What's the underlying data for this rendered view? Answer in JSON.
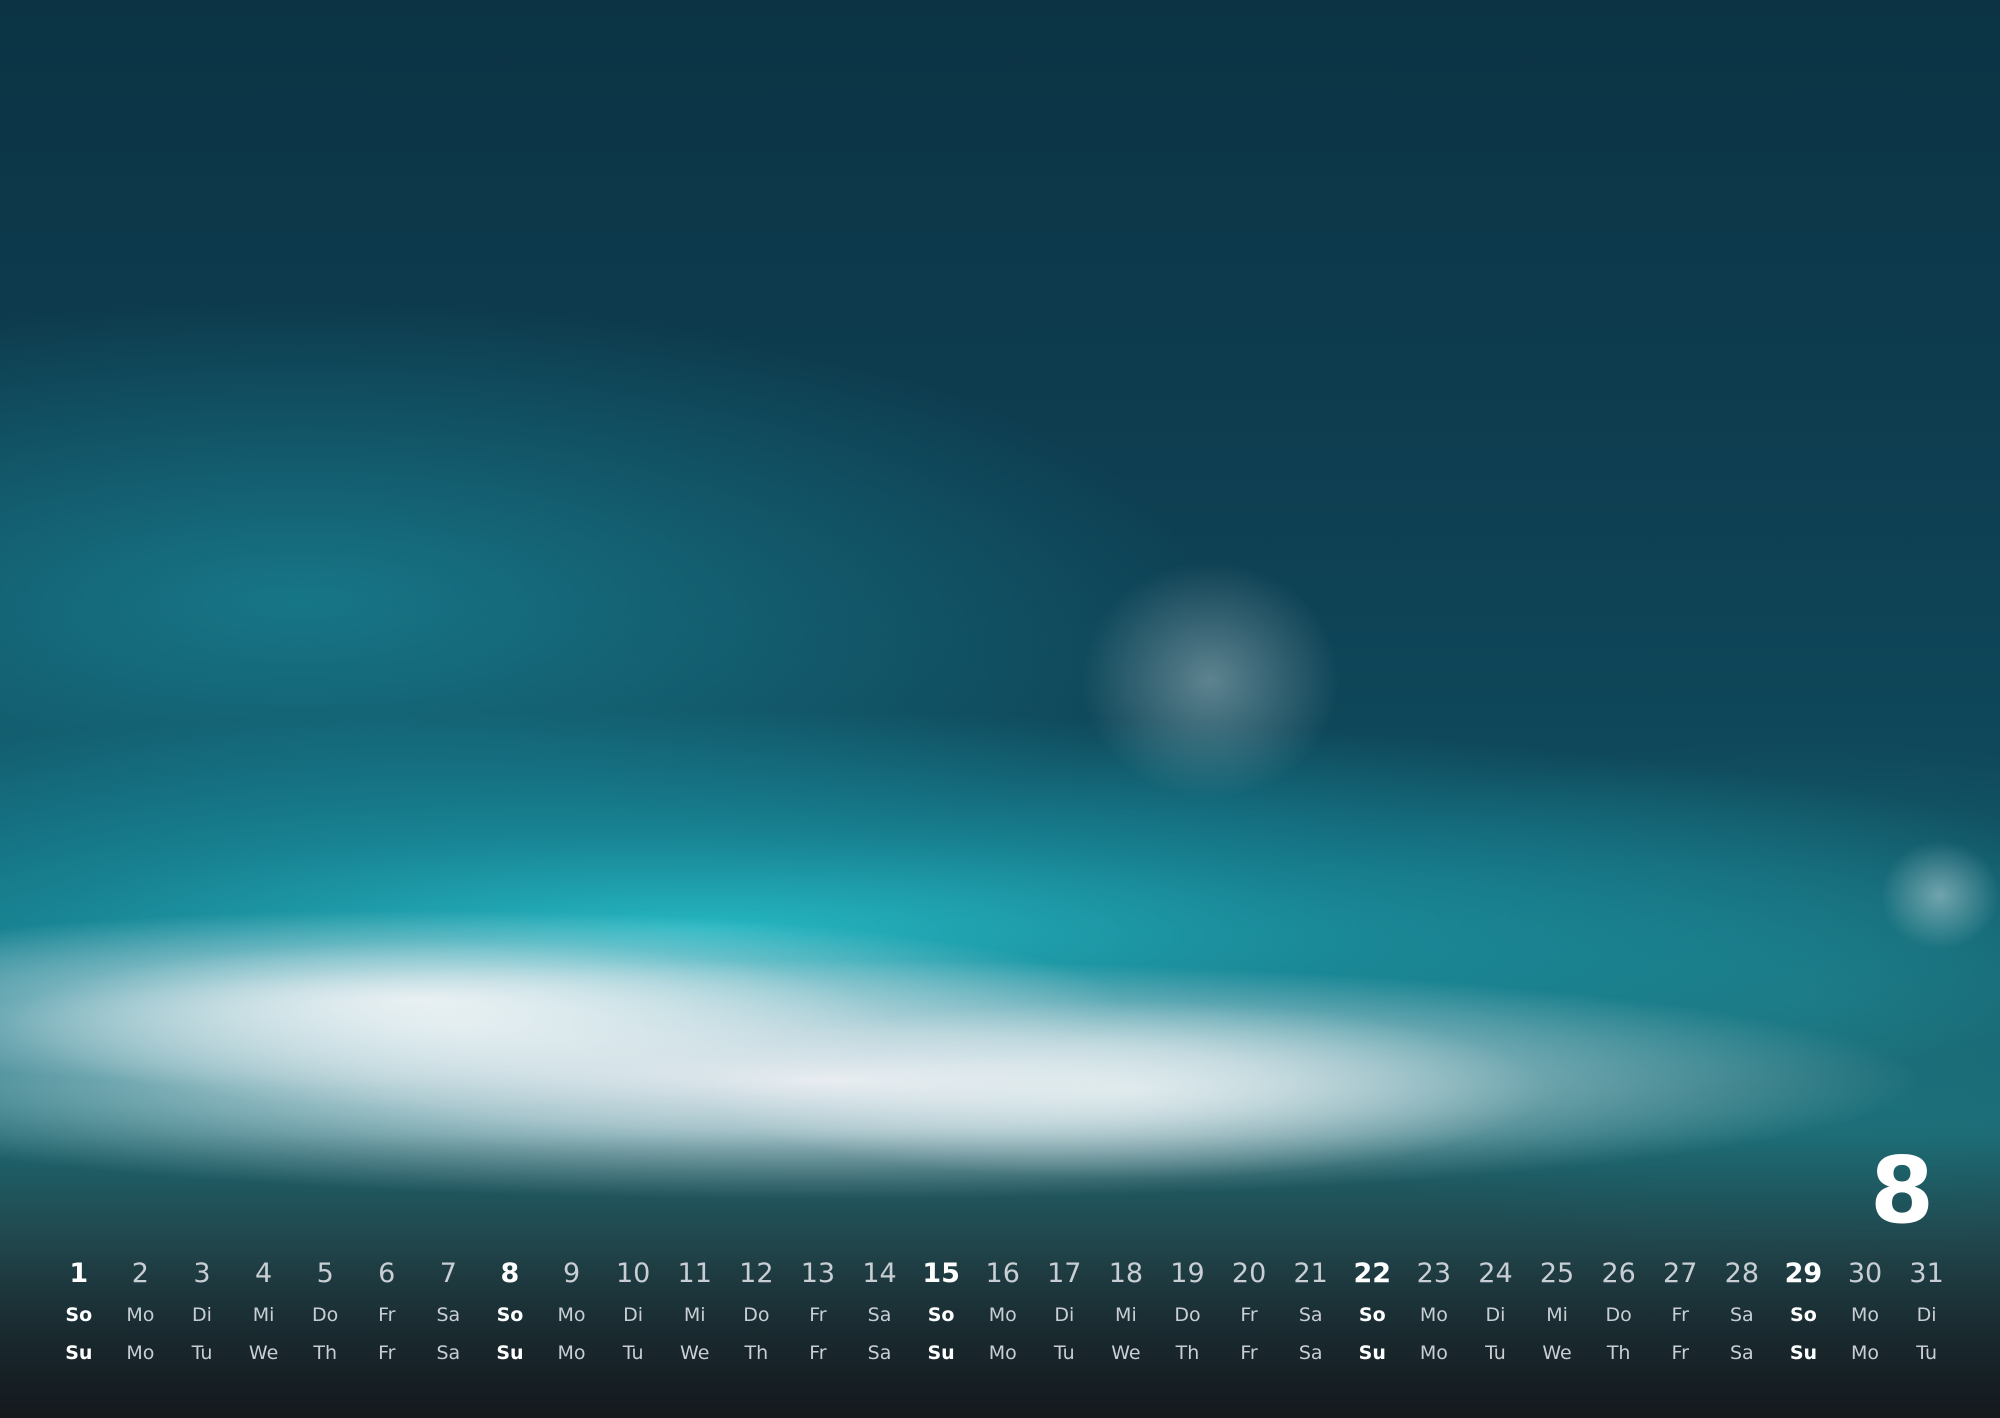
{
  "month": "8",
  "days": [
    {
      "num": "1",
      "de": "So",
      "en": "Su",
      "sunday": true
    },
    {
      "num": "2",
      "de": "Mo",
      "en": "Mo",
      "sunday": false
    },
    {
      "num": "3",
      "de": "Di",
      "en": "Tu",
      "sunday": false
    },
    {
      "num": "4",
      "de": "Mi",
      "en": "We",
      "sunday": false
    },
    {
      "num": "5",
      "de": "Do",
      "en": "Th",
      "sunday": false
    },
    {
      "num": "6",
      "de": "Fr",
      "en": "Fr",
      "sunday": false
    },
    {
      "num": "7",
      "de": "Sa",
      "en": "Sa",
      "sunday": false
    },
    {
      "num": "8",
      "de": "So",
      "en": "Su",
      "sunday": true
    },
    {
      "num": "9",
      "de": "Mo",
      "en": "Mo",
      "sunday": false
    },
    {
      "num": "10",
      "de": "Di",
      "en": "Tu",
      "sunday": false
    },
    {
      "num": "11",
      "de": "Mi",
      "en": "We",
      "sunday": false
    },
    {
      "num": "12",
      "de": "Do",
      "en": "Th",
      "sunday": false
    },
    {
      "num": "13",
      "de": "Fr",
      "en": "Fr",
      "sunday": false
    },
    {
      "num": "14",
      "de": "Sa",
      "en": "Sa",
      "sunday": false
    },
    {
      "num": "15",
      "de": "So",
      "en": "Su",
      "sunday": true
    },
    {
      "num": "16",
      "de": "Mo",
      "en": "Mo",
      "sunday": false
    },
    {
      "num": "17",
      "de": "Di",
      "en": "Tu",
      "sunday": false
    },
    {
      "num": "18",
      "de": "Mi",
      "en": "We",
      "sunday": false
    },
    {
      "num": "19",
      "de": "Do",
      "en": "Th",
      "sunday": false
    },
    {
      "num": "20",
      "de": "Fr",
      "en": "Fr",
      "sunday": false
    },
    {
      "num": "21",
      "de": "Sa",
      "en": "Sa",
      "sunday": false
    },
    {
      "num": "22",
      "de": "So",
      "en": "Su",
      "sunday": true
    },
    {
      "num": "23",
      "de": "Mo",
      "en": "Mo",
      "sunday": false
    },
    {
      "num": "24",
      "de": "Di",
      "en": "Tu",
      "sunday": false
    },
    {
      "num": "25",
      "de": "Mi",
      "en": "We",
      "sunday": false
    },
    {
      "num": "26",
      "de": "Do",
      "en": "Th",
      "sunday": false
    },
    {
      "num": "27",
      "de": "Fr",
      "en": "Fr",
      "sunday": false
    },
    {
      "num": "28",
      "de": "Sa",
      "en": "Sa",
      "sunday": false
    },
    {
      "num": "29",
      "de": "So",
      "en": "Su",
      "sunday": true
    },
    {
      "num": "30",
      "de": "Mo",
      "en": "Mo",
      "sunday": false
    },
    {
      "num": "31",
      "de": "Di",
      "en": "Tu",
      "sunday": false
    }
  ]
}
